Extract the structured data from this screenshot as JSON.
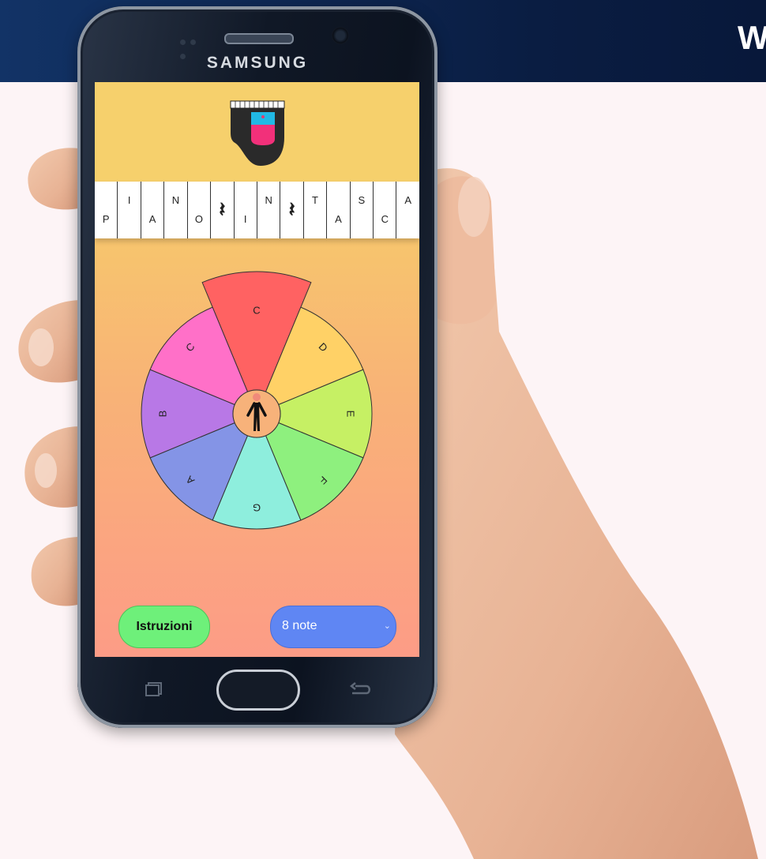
{
  "page": {
    "corner_logo": "W"
  },
  "phone": {
    "brand": "SAMSUNG"
  },
  "app": {
    "sequence": [
      {
        "text": "P",
        "pos": "lo"
      },
      {
        "text": "I",
        "pos": "hi"
      },
      {
        "text": "A",
        "pos": "lo"
      },
      {
        "text": "N",
        "pos": "hi"
      },
      {
        "text": "O",
        "pos": "lo"
      },
      {
        "text": "𝄽",
        "pos": "rest"
      },
      {
        "text": "I",
        "pos": "lo"
      },
      {
        "text": "N",
        "pos": "hi"
      },
      {
        "text": "𝄽",
        "pos": "rest"
      },
      {
        "text": "T",
        "pos": "hi"
      },
      {
        "text": "A",
        "pos": "lo"
      },
      {
        "text": "S",
        "pos": "hi"
      },
      {
        "text": "C",
        "pos": "lo"
      },
      {
        "text": "A",
        "pos": "hi"
      }
    ],
    "wheel": {
      "highlighted": "C",
      "segments": [
        {
          "note": "C",
          "color": "#ff6262"
        },
        {
          "note": "D",
          "color": "#ffd166"
        },
        {
          "note": "E",
          "color": "#c6f064"
        },
        {
          "note": "F",
          "color": "#8ef07e"
        },
        {
          "note": "G",
          "color": "#8eeedd"
        },
        {
          "note": "A",
          "color": "#8494e6"
        },
        {
          "note": "B",
          "color": "#b878e6"
        },
        {
          "note": "C",
          "color": "#ff70c8"
        }
      ],
      "center_icon": "person-icon"
    },
    "instructions_label": "Istruzioni",
    "notes_select": {
      "value": "8 note"
    }
  }
}
